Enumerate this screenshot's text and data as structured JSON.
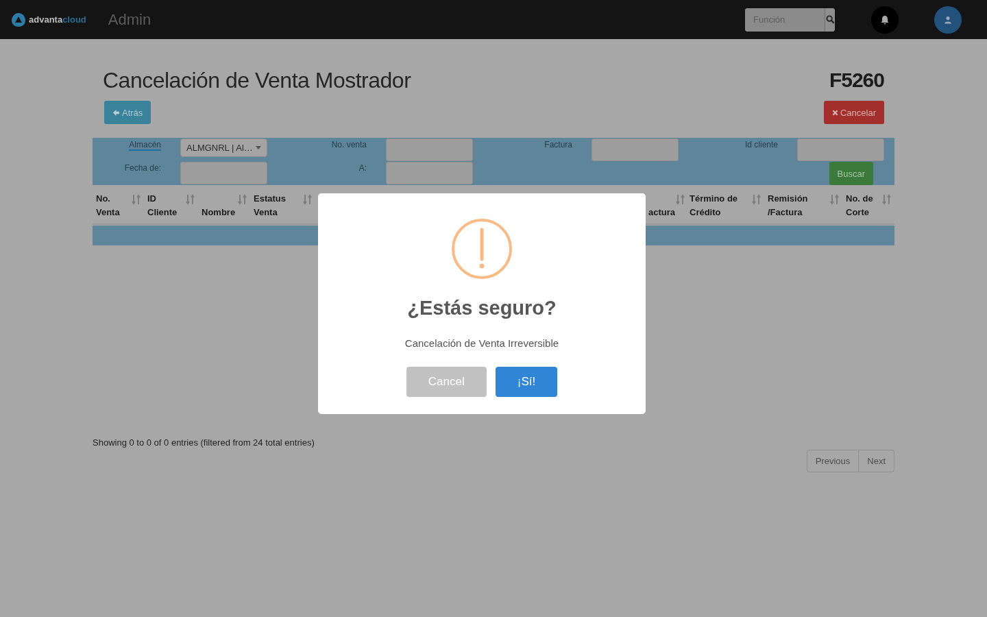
{
  "header": {
    "brand_prefix": "advanta",
    "brand_suffix": "cloud",
    "section": "Admin",
    "search": {
      "placeholder": "Función"
    }
  },
  "page": {
    "title": "Cancelación de Venta Mostrador",
    "code": "F5260",
    "back_button": "Atrás",
    "cancel_button": "Cancelar"
  },
  "filters": {
    "warehouse": {
      "label": "Almacén",
      "value": "ALMGNRL | Al…"
    },
    "fields": [
      {
        "label": "No. venta"
      },
      {
        "label": "Factura"
      },
      {
        "label": "Id cliente"
      },
      {
        "label": "Fecha de:"
      },
      {
        "label": "A:"
      }
    ],
    "search_button": "Buscar"
  },
  "table": {
    "columns": [
      {
        "label": "No. Venta"
      },
      {
        "label": "ID Cliente"
      },
      {
        "label": "Nombre"
      },
      {
        "label": "Estatus Venta"
      },
      {
        "label": "actura"
      },
      {
        "label": "Término de Crédito"
      },
      {
        "label": "Remisión /Factura"
      },
      {
        "label": "No. de Corte"
      }
    ]
  },
  "footer": {
    "info": "Showing 0 to 0 of 0 entries (filtered from 24 total entries)",
    "pagination": [
      {
        "label": "Previous",
        "disabled": true
      },
      {
        "label": "Next",
        "disabled": true
      }
    ]
  },
  "dialog": {
    "title": "¿Estás seguro?",
    "message": "Cancelación de Venta Irreversible",
    "buttons": [
      {
        "label": "Cancel",
        "kind": "cancel"
      },
      {
        "label": "¡Sí!",
        "kind": "confirm"
      }
    ]
  }
}
